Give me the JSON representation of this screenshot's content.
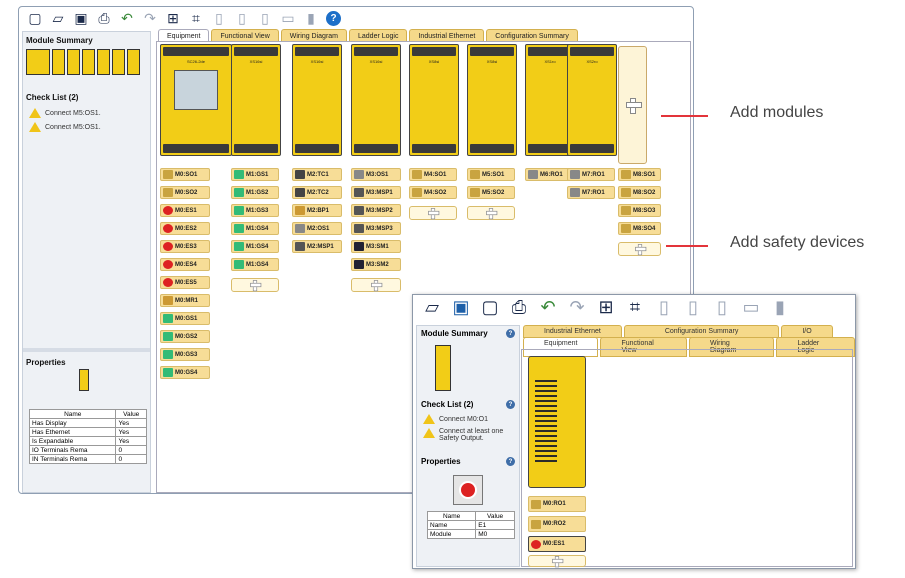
{
  "toolbar": {
    "icons": [
      "new-file",
      "open-folder",
      "save",
      "print",
      "undo",
      "redo",
      "print-preview",
      "network",
      "page-a",
      "page-b",
      "page-c",
      "page-d",
      "pin",
      "help"
    ]
  },
  "sidebar": {
    "module_summary": "Module Summary",
    "check_list": "Check List (2)",
    "checks": [
      "Connect M5:OS1.",
      "Connect M5:OS1."
    ],
    "properties": "Properties"
  },
  "props": {
    "headers": [
      "Name",
      "Value"
    ],
    "rows": [
      [
        "Has Display",
        "Yes"
      ],
      [
        "Has Ethernet",
        "Yes"
      ],
      [
        "Is Expandable",
        "Yes"
      ],
      [
        "IO Terminals Rema",
        "0"
      ],
      [
        "IN Terminals Rema",
        "0"
      ]
    ]
  },
  "tabs": [
    "Equipment",
    "Functional View",
    "Wiring Diagram",
    "Ladder Logic",
    "Industrial Ethernet",
    "Configuration Summary"
  ],
  "modules": [
    "SC26-2de",
    "XS16si",
    "XS16si",
    "XS16si",
    "XS8si",
    "XS8si",
    "XS1ro",
    "XS2ro"
  ],
  "devices": [
    [
      "M0:SO1",
      "M0:SO2",
      "M0:ES1",
      "M0:ES2",
      "M0:ES3",
      "M0:ES4",
      "M0:ES5",
      "M0:MR1",
      "M0:GS1",
      "M0:GS2",
      "M0:GS3",
      "M0:GS4"
    ],
    [
      "M1:GS1",
      "M1:GS2",
      "M1:GS3",
      "M1:GS4",
      "M1:GS4",
      "M1:GS4"
    ],
    [
      "M2:TC1",
      "M2:TC2",
      "M2:BP1",
      "M2:OS1",
      "M2:MSP1"
    ],
    [
      "M3:OS1",
      "M3:MSP1",
      "M3:MSP2",
      "M3:MSP3",
      "M3:SM1",
      "M3:SM2"
    ],
    [
      "M4:SO1",
      "M4:SO2"
    ],
    [
      "M5:SO1",
      "M5:SO2"
    ],
    [
      "M6:RO1"
    ],
    [
      "M7:RO1",
      "M7:RO1"
    ],
    [
      "M8:SO1",
      "M8:SO2",
      "M8:SO3",
      "M8:SO4"
    ]
  ],
  "callouts": {
    "add_modules": "Add modules",
    "add_safety": "Add safety devices"
  },
  "zoom": {
    "module_summary": "Module Summary",
    "check_list": "Check List (2)",
    "checks": [
      "Connect M0:O1",
      "Connect at least one Safety Output."
    ],
    "properties": "Properties",
    "tabs_top": [
      "Industrial Ethernet",
      "Configuration Summary",
      "I/O"
    ],
    "tabs": [
      "Equipment",
      "Functional View",
      "Wiring Diagram",
      "Ladder Logic"
    ],
    "props_headers": [
      "Name",
      "Value"
    ],
    "props_rows": [
      [
        "Name",
        "E1"
      ],
      [
        "Module",
        "M0"
      ]
    ],
    "devices": [
      "M0:RO1",
      "M0:RO2",
      "M0:ES1"
    ]
  }
}
